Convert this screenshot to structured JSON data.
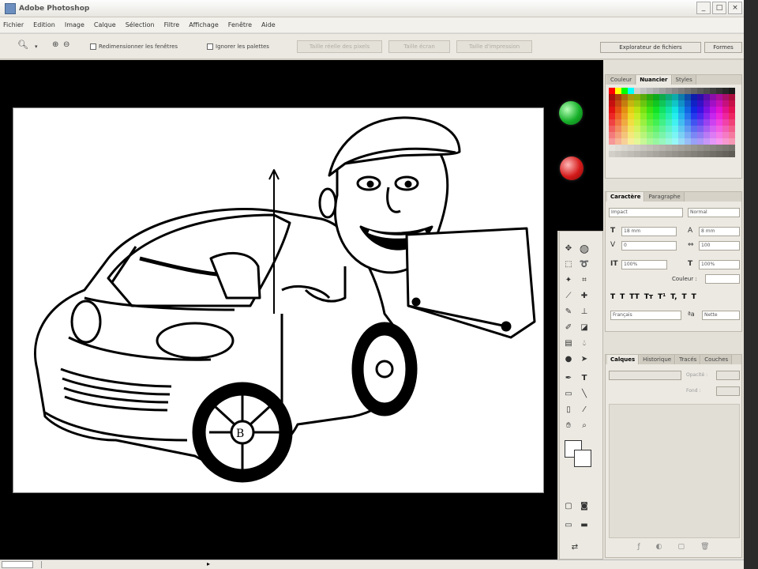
{
  "window": {
    "title": "Adobe Photoshop",
    "buttons": [
      "_",
      "□",
      "×"
    ]
  },
  "menu": [
    "Fichier",
    "Edition",
    "Image",
    "Calque",
    "Sélection",
    "Filtre",
    "Affichage",
    "Fenêtre",
    "Aide"
  ],
  "options_bar": {
    "zoom_icon": "magnifier-icon",
    "resize_windows_label": "Redimensionner les fenêtres",
    "ignore_palettes_label": "Ignorer les palettes",
    "buttons": [
      "Taille réelle des pixels",
      "Taille écran",
      "Taille d'impression"
    ]
  },
  "top_tabs": [
    "Explorateur de fichiers",
    "Formes"
  ],
  "swatches_panel": {
    "tabs": [
      "Couleur",
      "Nuancier",
      "Styles"
    ],
    "active": 1
  },
  "character_panel": {
    "tabs": [
      "Caractère",
      "Paragraphe"
    ],
    "font_family": "Impact",
    "font_style": "Normal",
    "font_size": "18 mm",
    "leading": "8 mm",
    "tracking": "0",
    "kerning": "100",
    "vscale": "100%",
    "hscale": "100%",
    "color_label": "Couleur :",
    "style_buttons": [
      "T",
      "T",
      "TT",
      "Tт",
      "T¹",
      "T,",
      "T",
      "T"
    ],
    "language": "Français",
    "antialias": "Nette"
  },
  "layers_panel": {
    "tabs": [
      "Calques",
      "Historique",
      "Tracés",
      "Couches"
    ],
    "opacity_label": "Opacité :",
    "fill_label": "Fond :"
  },
  "accent": {
    "green": "#17b02a",
    "red": "#d51a1a"
  },
  "toolbox": [
    "move-icon",
    "marquee-icon",
    "lasso-icon",
    "magic-wand-icon",
    "crop-icon",
    "slice-icon",
    "healing-icon",
    "brush-icon",
    "clone-stamp-icon",
    "history-brush-icon",
    "eraser-icon",
    "gradient-icon",
    "blur-icon",
    "dodge-icon",
    "path-select-icon",
    "type-icon",
    "pen-icon",
    "shape-icon",
    "notes-icon",
    "eyedropper-icon",
    "hand-icon",
    "zoom-icon"
  ]
}
